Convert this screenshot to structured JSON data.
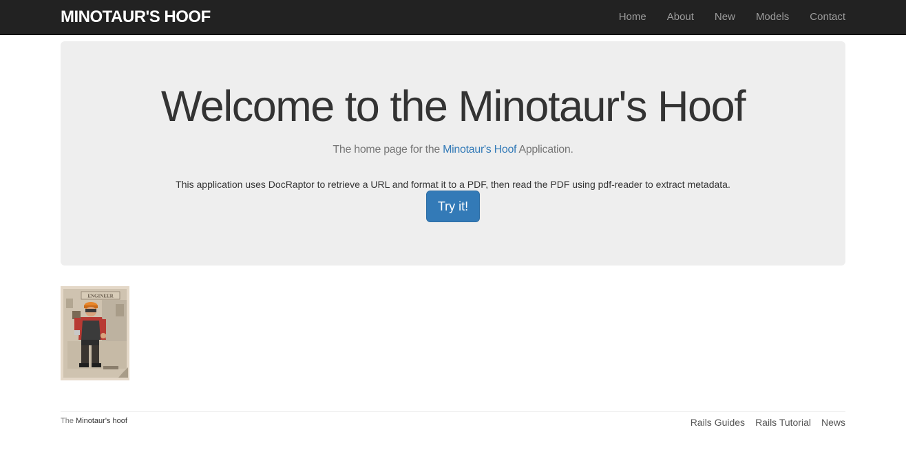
{
  "navbar": {
    "brand": "MINOTAUR'S HOOF",
    "links": [
      {
        "label": "Home"
      },
      {
        "label": "About"
      },
      {
        "label": "New"
      },
      {
        "label": "Models"
      },
      {
        "label": "Contact"
      }
    ]
  },
  "hero": {
    "title": "Welcome to the Minotaur's Hoof",
    "subtitle_prefix": "The home page for the ",
    "subtitle_link": "Minotaur's Hoof",
    "subtitle_suffix": " Application.",
    "description": "This application uses DocRaptor to retrieve a URL and format it to a PDF, then read the PDF using pdf-reader to extract metadata.",
    "button_label": "Try it!"
  },
  "poster": {
    "heading": "ENGINEER",
    "icon": "engineer-poster-image"
  },
  "footer": {
    "left_prefix": "The ",
    "left_link": "Minotaur's hoof",
    "links": [
      {
        "label": "Rails Guides"
      },
      {
        "label": "Rails Tutorial"
      },
      {
        "label": "News"
      }
    ]
  },
  "colors": {
    "navbar_bg": "#222222",
    "jumbotron_bg": "#eeeeee",
    "primary": "#337ab7",
    "nav_link": "#9d9d9d"
  }
}
